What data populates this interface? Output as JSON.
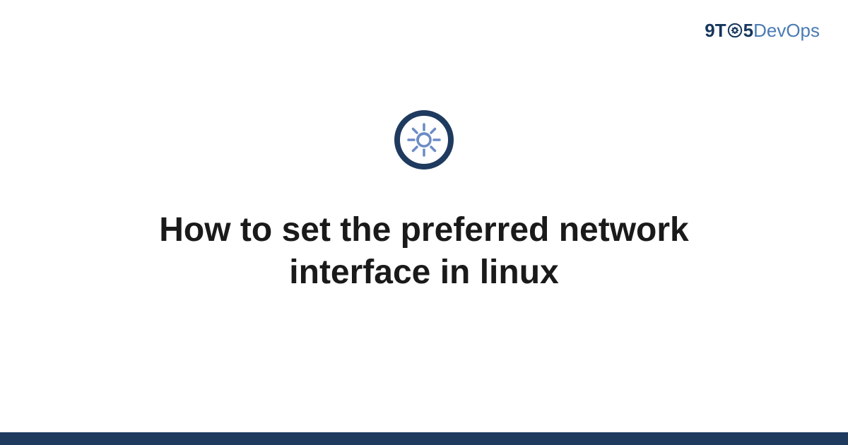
{
  "logo": {
    "part1": "9T",
    "part2": "5",
    "part3": "DevOps"
  },
  "title": "How to set the preferred network interface in linux",
  "colors": {
    "brand_dark": "#16365c",
    "brand_light": "#4a7bb5",
    "icon_ring": "#1f3a5f",
    "icon_gear": "#6b8cc4",
    "footer": "#1f3a5f"
  }
}
